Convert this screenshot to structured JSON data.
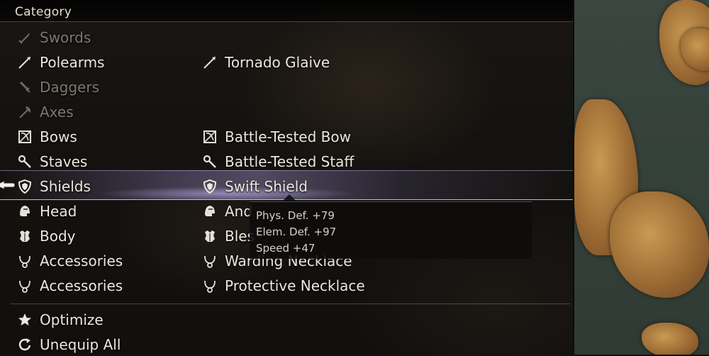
{
  "header": {
    "title": "Category"
  },
  "categories": [
    {
      "label": "Swords",
      "icon": "sword-icon",
      "disabled": true
    },
    {
      "label": "Polearms",
      "icon": "polearm-icon",
      "disabled": false
    },
    {
      "label": "Daggers",
      "icon": "dagger-icon",
      "disabled": true
    },
    {
      "label": "Axes",
      "icon": "axe-icon",
      "disabled": true
    },
    {
      "label": "Bows",
      "icon": "bow-icon",
      "disabled": false
    },
    {
      "label": "Staves",
      "icon": "staff-icon",
      "disabled": false
    },
    {
      "label": "Shields",
      "icon": "shield-icon",
      "disabled": false,
      "selected": true
    },
    {
      "label": "Head",
      "icon": "helmet-icon",
      "disabled": false
    },
    {
      "label": "Body",
      "icon": "armor-icon",
      "disabled": false
    },
    {
      "label": "Accessories",
      "icon": "necklace-icon",
      "disabled": false
    },
    {
      "label": "Accessories",
      "icon": "necklace-icon",
      "disabled": false
    }
  ],
  "equipped": [
    {
      "slot": 1,
      "label": "Tornado Glaive",
      "icon": "polearm-icon"
    },
    {
      "slot": 4,
      "label": "Battle-Tested Bow",
      "icon": "bow-icon"
    },
    {
      "slot": 5,
      "label": "Battle-Tested Staff",
      "icon": "staff-icon"
    },
    {
      "slot": 6,
      "label": "Swift Shield",
      "icon": "shield-icon"
    },
    {
      "slot": 7,
      "label": "And",
      "icon": "helmet-icon"
    },
    {
      "slot": 8,
      "label": "Bles",
      "icon": "armor-icon"
    },
    {
      "slot": 9,
      "label": "Warding Necklace",
      "icon": "necklace-icon"
    },
    {
      "slot": 10,
      "label": "Protective Necklace",
      "icon": "necklace-icon"
    }
  ],
  "tooltip": {
    "lines": [
      "Phys. Def. +79",
      "Elem. Def. +97",
      "Speed +47"
    ]
  },
  "commands": [
    {
      "label": "Optimize",
      "icon": "star-icon"
    },
    {
      "label": "Unequip All",
      "icon": "unequip-icon"
    }
  ],
  "colors": {
    "text": "#ece7de",
    "disabled_text": "#7d776f",
    "highlight": "#b4a8e6"
  }
}
